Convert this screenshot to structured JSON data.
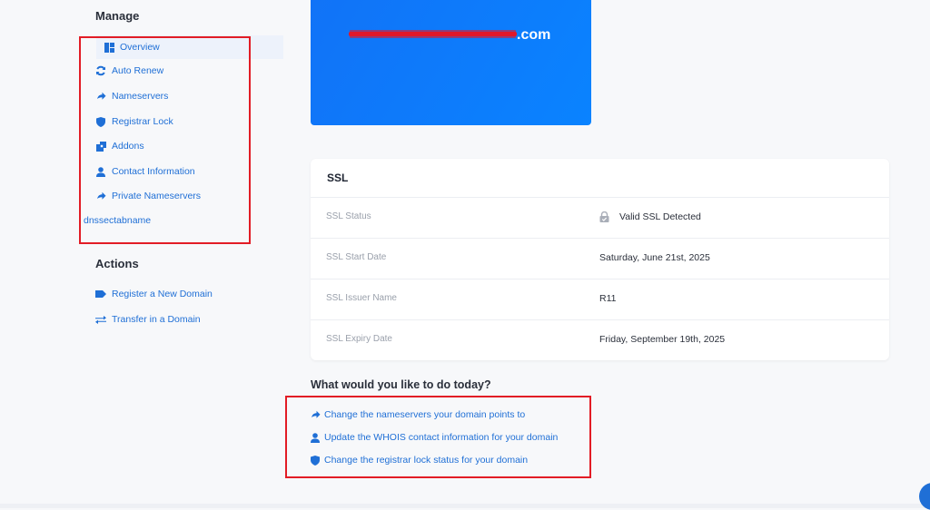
{
  "sidebar": {
    "manage_heading": "Manage",
    "manage_items": [
      {
        "label": "Overview",
        "icon": "overview-icon"
      },
      {
        "label": "Auto Renew",
        "icon": "auto-renew-icon"
      },
      {
        "label": "Nameservers",
        "icon": "arrow-right-icon"
      },
      {
        "label": "Registrar Lock",
        "icon": "shield-icon"
      },
      {
        "label": "Addons",
        "icon": "addons-icon"
      },
      {
        "label": "Contact Information",
        "icon": "user-icon"
      },
      {
        "label": "Private Nameservers",
        "icon": "arrow-right-icon"
      },
      {
        "label": "dnssectabname",
        "icon": ""
      }
    ],
    "actions_heading": "Actions",
    "action_items": [
      {
        "label": "Register a New Domain",
        "icon": "tag-icon"
      },
      {
        "label": "Transfer in a Domain",
        "icon": "transfer-icon"
      }
    ]
  },
  "banner": {
    "domain_suffix": ".com",
    "accent_color": "#1173f7"
  },
  "ssl": {
    "title": "SSL",
    "rows": [
      {
        "label": "SSL Status",
        "value": "Valid SSL Detected"
      },
      {
        "label": "SSL Start Date",
        "value": "Saturday, June 21st, 2025"
      },
      {
        "label": "SSL Issuer Name",
        "value": "R11"
      },
      {
        "label": "SSL Expiry Date",
        "value": "Friday, September 19th, 2025"
      }
    ]
  },
  "todo": {
    "title": "What would you like to do today?",
    "links": [
      {
        "label": "Change the nameservers your domain points to",
        "icon": "arrow-right-icon"
      },
      {
        "label": "Update the WHOIS contact information for your domain",
        "icon": "user-icon"
      },
      {
        "label": "Change the registrar lock status for your domain",
        "icon": "shield-icon"
      }
    ]
  },
  "colors": {
    "link": "#1f6fd6",
    "highlight_border": "#e21c25",
    "redaction": "#e0182a"
  }
}
